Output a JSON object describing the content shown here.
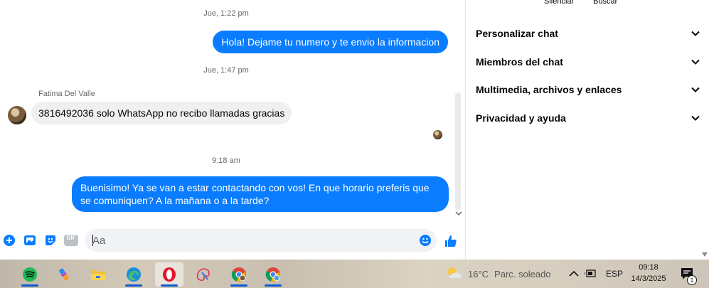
{
  "chat": {
    "messages": [
      {
        "kind": "timestamp",
        "text": "Jue, 1:22 pm"
      },
      {
        "kind": "outgoing",
        "text": "Hola! Dejame tu numero y te envio la informacion"
      },
      {
        "kind": "timestamp",
        "text": "Jue, 1:47 pm"
      },
      {
        "kind": "sender",
        "text": "Fatima Del Valle"
      },
      {
        "kind": "incoming",
        "text": "3816492036 solo WhatsApp no recibo llamadas gracias"
      },
      {
        "kind": "timestamp",
        "text": "9:18 am"
      },
      {
        "kind": "outgoing",
        "text": "Buenisimo! Ya se van a estar contactando con vos! En que horario preferis que se comuniquen? A la mañana o a la tarde?"
      }
    ]
  },
  "composer": {
    "placeholder": "Aa",
    "gif_label": "GIF",
    "icons": [
      "plus-icon",
      "photo-icon",
      "sticker-icon",
      "gif-icon",
      "emoji-icon",
      "like-icon"
    ]
  },
  "sidebar": {
    "top_actions": [
      "Silenciar",
      "Buscar"
    ],
    "sections": [
      {
        "label": "Personalizar chat"
      },
      {
        "label": "Miembros del chat"
      },
      {
        "label": "Multimedia, archivos y enlaces"
      },
      {
        "label": "Privacidad y ayuda"
      }
    ]
  },
  "taskbar": {
    "apps": [
      "spotify",
      "copilot",
      "file-explorer",
      "edge",
      "opera",
      "paint",
      "chrome-1",
      "chrome-2"
    ],
    "weather": {
      "temp": "16°C",
      "condition": "Parc. soleado"
    },
    "language": "ESP",
    "clock": {
      "time": "09:18",
      "date": "14/3/2025"
    },
    "notifications": "1"
  },
  "colors": {
    "accent": "#0a7cff",
    "incoming_bubble": "#f0f0f0",
    "muted_text": "#65676b"
  }
}
